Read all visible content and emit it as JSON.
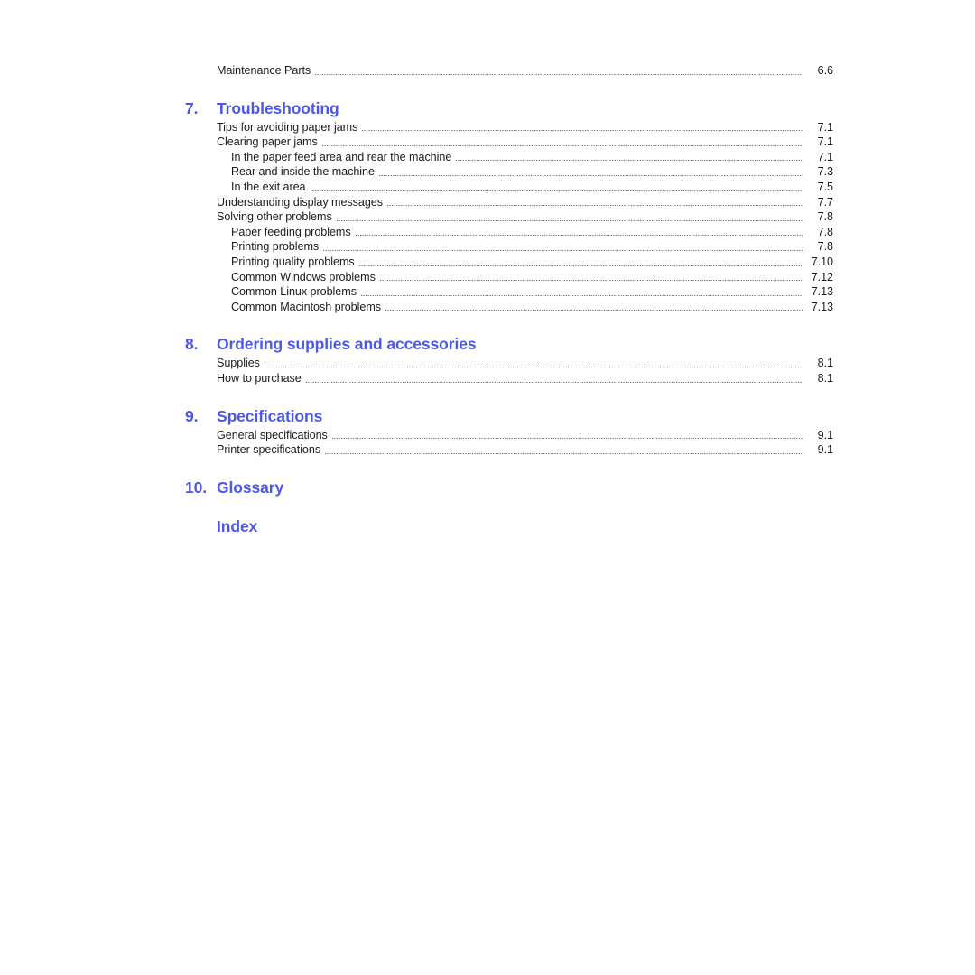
{
  "document": {
    "type": "table-of-contents",
    "accent_color": "#4b57e6",
    "text_color": "#1b1b1b",
    "leader_color": "#5a5a5a",
    "background": "#ffffff"
  },
  "orphan_entries": [
    {
      "label": "Maintenance Parts",
      "page": "6.6",
      "level": 1
    }
  ],
  "chapters": [
    {
      "number": "7.",
      "title": "Troubleshooting",
      "entries": [
        {
          "label": "Tips for avoiding paper jams",
          "page": "7.1",
          "level": 1
        },
        {
          "label": "Clearing paper jams",
          "page": "7.1",
          "level": 1
        },
        {
          "label": "In the paper feed area and rear the machine",
          "page": "7.1",
          "level": 2
        },
        {
          "label": "Rear and inside the machine",
          "page": "7.3",
          "level": 2
        },
        {
          "label": "In the exit area",
          "page": "7.5",
          "level": 2
        },
        {
          "label": "Understanding display messages",
          "page": "7.7",
          "level": 1
        },
        {
          "label": "Solving other problems",
          "page": "7.8",
          "level": 1
        },
        {
          "label": "Paper feeding problems",
          "page": "7.8",
          "level": 2
        },
        {
          "label": "Printing problems",
          "page": "7.8",
          "level": 2
        },
        {
          "label": "Printing quality problems",
          "page": "7.10",
          "level": 2
        },
        {
          "label": "Common Windows problems",
          "page": "7.12",
          "level": 2
        },
        {
          "label": "Common Linux problems",
          "page": "7.13",
          "level": 2
        },
        {
          "label": "Common Macintosh problems",
          "page": "7.13",
          "level": 2
        }
      ]
    },
    {
      "number": "8.",
      "title": "Ordering supplies and accessories",
      "entries": [
        {
          "label": "Supplies",
          "page": "8.1",
          "level": 1
        },
        {
          "label": "How to purchase",
          "page": "8.1",
          "level": 1
        }
      ]
    },
    {
      "number": "9.",
      "title": "Specifications",
      "entries": [
        {
          "label": "General specifications",
          "page": "9.1",
          "level": 1
        },
        {
          "label": "Printer specifications",
          "page": "9.1",
          "level": 1
        }
      ]
    },
    {
      "number": "10.",
      "title": "Glossary",
      "entries": []
    },
    {
      "number": "",
      "title": "Index",
      "entries": []
    }
  ]
}
